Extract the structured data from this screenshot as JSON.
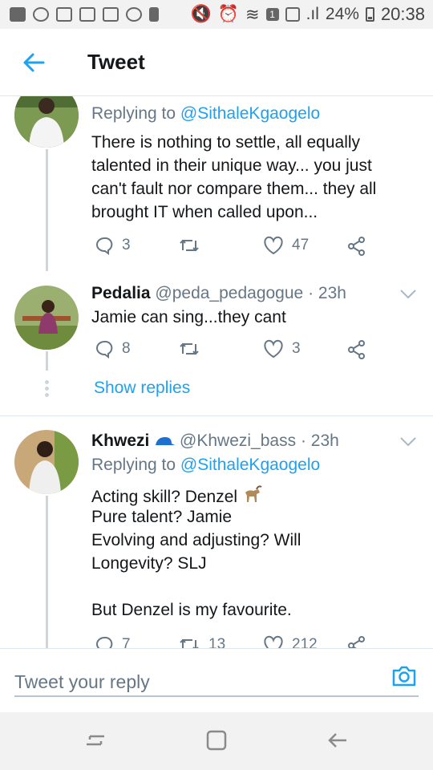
{
  "status_bar": {
    "battery": "24%",
    "time": "20:38",
    "sim": "1"
  },
  "header": {
    "title": "Tweet"
  },
  "tweets": [
    {
      "replying_prefix": "Replying to",
      "replying_handle": "@SithaleKgaogelo",
      "text_lines": [
        "There is nothing to settle, all equally",
        "talented in their unique way... you just",
        "can't fault nor compare them... they all",
        "brought IT when called upon..."
      ],
      "replies": "3",
      "likes": "47"
    },
    {
      "name": "Pedalia",
      "handle": "@peda_pedagogue",
      "time": "· 23h",
      "text_lines": [
        "Jamie can sing...they cant"
      ],
      "replies": "8",
      "likes": "3",
      "show_replies": "Show replies"
    },
    {
      "name": "Khwezi",
      "handle": "@Khwezi_bass",
      "time": "· 23h",
      "replying_prefix": "Replying to",
      "replying_handle": "@SithaleKgaogelo",
      "text_lines": [
        "Acting skill? Denzel",
        "Pure talent? Jamie",
        "Evolving and adjusting? Will",
        "Longevity? SLJ",
        "",
        "But Denzel is my favourite."
      ],
      "replies": "7",
      "retweets": "13",
      "likes": "212"
    }
  ],
  "reply_bar": {
    "placeholder": "Tweet your reply"
  },
  "colors": {
    "accent": "#1da1f2",
    "muted": "#657786",
    "text": "#14171a"
  }
}
